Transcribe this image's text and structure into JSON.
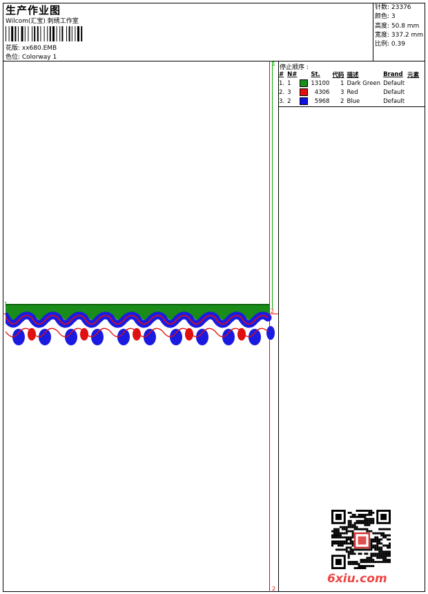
{
  "header": {
    "title": "生产作业图",
    "subtitle": "Wilcom(汇宝) 刺绣工作室",
    "pattern_label": "花版: xx680.EMB",
    "colorway_label": "色位: Colorway 1"
  },
  "stats": {
    "stitches": "针数: 23376",
    "colors": "颜色: 3",
    "height": "高度: 50.8 mm",
    "width": "宽度: 337.2 mm",
    "scale": "比例: 0.39"
  },
  "markers": {
    "top": "1",
    "bottom": "2",
    "left": "1",
    "right": "2"
  },
  "stop_sequence": {
    "title": "停止顺序 :",
    "headers": [
      "#",
      "N#",
      "",
      "St.",
      "代码",
      "描述",
      "Brand",
      "元素"
    ],
    "rows": [
      {
        "idx": "1.",
        "n": "1",
        "color": "#1a8c1a",
        "st": "13100",
        "code": "1",
        "desc": "Dark Green",
        "brand": "Default"
      },
      {
        "idx": "2.",
        "n": "3",
        "color": "#e01010",
        "st": "4306",
        "code": "3",
        "desc": "Red",
        "brand": "Default"
      },
      {
        "idx": "3.",
        "n": "2",
        "color": "#1010e0",
        "st": "5968",
        "code": "2",
        "desc": "Blue",
        "brand": "Default"
      }
    ]
  },
  "watermark": "6xiu.com",
  "colors": {
    "green": "#1a8c1a",
    "red": "#e01010",
    "blue": "#1a1ae0",
    "guide_red": "#e00000"
  }
}
